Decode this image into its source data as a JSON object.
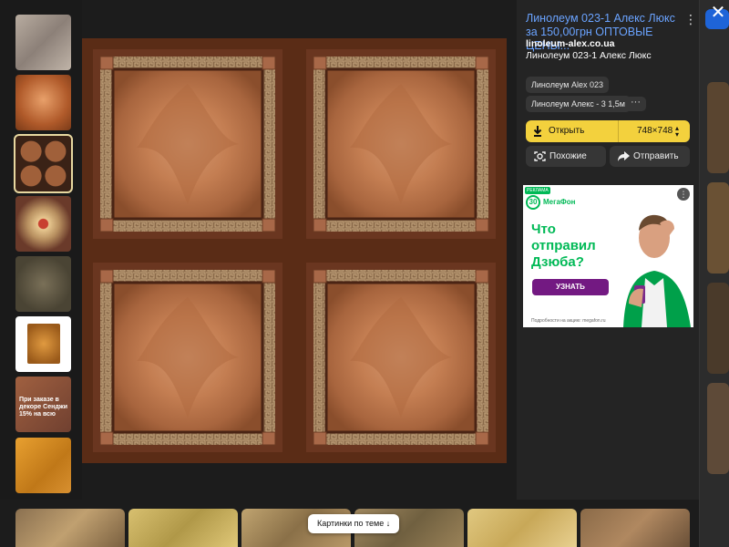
{
  "window": {
    "close_label": "✕"
  },
  "result": {
    "title": "Линолеум 023-1 Алекс Люкс за 150,00грн ОПТОВЫЕ ЦЕНЫ...",
    "domain": "linoleum-alex.co.ua",
    "subtitle": "Линолеум 023-1 Алекс Люкс",
    "menu_label": "⋮"
  },
  "tags": [
    {
      "label": "Линолеум Alex 023"
    },
    {
      "label": "Линолеум Алекс - 3 1,5м"
    }
  ],
  "tags_more_label": "···",
  "open_button": {
    "label": "Открыть",
    "size": "748×748",
    "caret": "▲▼"
  },
  "actions": {
    "similar_label": "Похожие",
    "share_label": "Отправить"
  },
  "ad": {
    "badge": "РЕКЛАМА",
    "logo_number": "30",
    "logo_text": "МегаФон",
    "headline": "Что отправил Дзюба?",
    "cta": "УЗНАТЬ",
    "fine_print": "Подробности на акцию: megafon.ru",
    "menu_label": "⋮"
  },
  "thumbnails": {
    "promo_text": "При заказе в декоре Сенджи 15% на всю"
  },
  "related": {
    "label": "Картинки по теме ↓"
  },
  "colors": {
    "accent_link": "#6aa3ff",
    "open_button": "#f3d13d",
    "ad_green": "#00b956",
    "ad_purple": "#731982"
  }
}
